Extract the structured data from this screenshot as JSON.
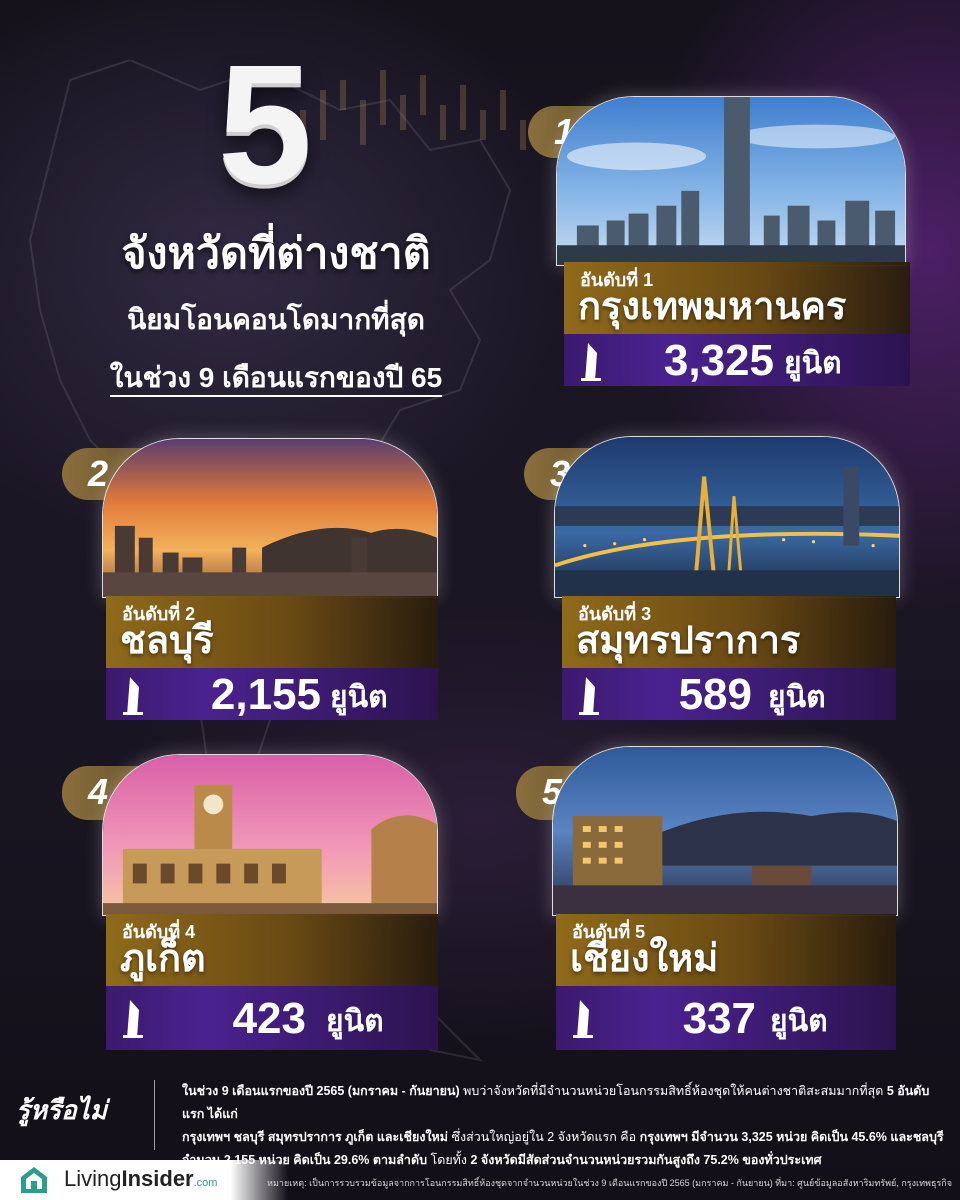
{
  "headline": {
    "big_number": "5",
    "line1": "จังหวัดที่ต่างชาติ",
    "line2": "นิยมโอนคอนโดมากที่สุด",
    "line3": "ในช่วง 9 เดือนแรกของปี 65"
  },
  "rankings": [
    {
      "rank": "1",
      "rank_label": "อันดับที่ 1",
      "province": "กรุงเทพมหานคร",
      "count": "3,325",
      "unit": "ยูนิต"
    },
    {
      "rank": "2",
      "rank_label": "อันดับที่ 2",
      "province": "ชลบุรี",
      "count": "2,155",
      "unit": "ยูนิต"
    },
    {
      "rank": "3",
      "rank_label": "อันดับที่ 3",
      "province": "สมุทรปราการ",
      "count": "589",
      "unit": "ยูนิต"
    },
    {
      "rank": "4",
      "rank_label": "อันดับที่ 4",
      "province": "ภูเก็ต",
      "count": "423",
      "unit": "ยูนิต"
    },
    {
      "rank": "5",
      "rank_label": "อันดับที่ 5",
      "province": "เชียงใหม่",
      "count": "337",
      "unit": "ยูนิต"
    }
  ],
  "did_you_know": {
    "title": "รู้หรือไม่",
    "line1a": "ในช่วง 9 เดือนแรกของปี 2565 (มกราคม - กันยายน)",
    "line1b": " พบว่าจังหวัดที่มีจำนวนหน่วยโอนกรรมสิทธิ์ห้องชุดให้คนต่างชาติสะสมมากที่สุด ",
    "line1c": "5 อันดับแรก ได้แก่",
    "line2a": "กรุงเทพฯ ชลบุรี สมุทรปราการ ภูเก็ต และเชียงใหม่",
    "line2b": " ซึ่งส่วนใหญ่อยู่ใน 2 จังหวัดแรก คือ ",
    "line2c": "กรุงเทพฯ มีจำนวน 3,325 หน่วย คิดเป็น 45.6% และชลบุรี",
    "line3a": "จำนวน 2,155 หน่วย คิดเป็น 29.6% ตามลำดับ",
    "line3b": " โดยทั้ง ",
    "line3c": "2 จังหวัดมีสัดส่วนจำนวนหน่วยรวมกันสูงถึง 75.2% ของทั่วประเทศ"
  },
  "brand": {
    "name_regular": "Living",
    "name_bold": "Insider",
    "domain": ".com"
  },
  "footnote": "หมายเหตุ: เป็นการรวบรวมข้อมูลจากการโอนกรรมสิทธิ์ห้องชุดจากจำนวนหน่วยในช่วง 9 เดือนแรกของปี 2565 (มกราคม - กันยายน)  ที่มา: ศูนย์ข้อมูลอสังหาริมทรัพย์, กรุงเทพธุรกิจ",
  "colors": {
    "gold": "#8f6a1a",
    "purple": "#4a2290",
    "brand_teal": "#2a9d8f"
  },
  "icons": {
    "unit_icon": "tower-icon",
    "logo_icon": "house-logo-icon"
  }
}
